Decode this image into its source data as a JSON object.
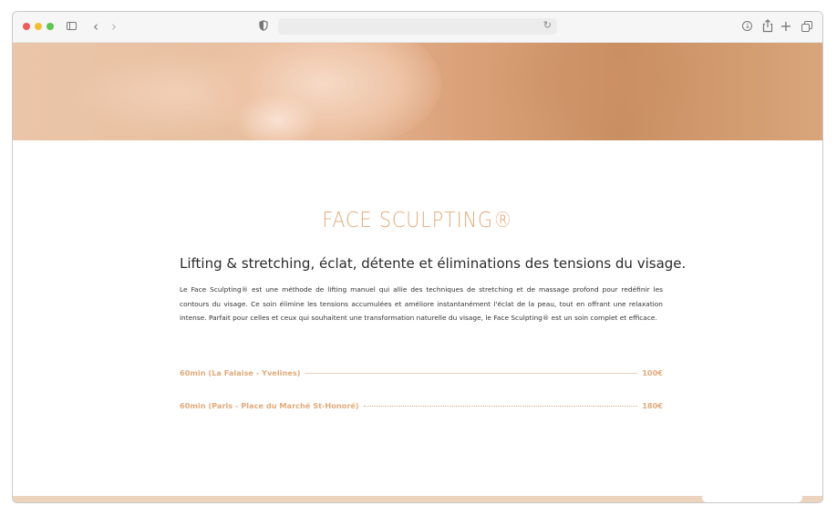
{
  "browser": {
    "url": "",
    "icons": {
      "sidebar": "sidebar-icon",
      "back": "chevron-left-icon",
      "forward": "chevron-right-icon",
      "shield": "shield-icon",
      "reload": "reload-icon",
      "download": "download-icon",
      "share": "share-icon",
      "new_tab": "plus-icon",
      "tabs": "tabs-overview-icon"
    },
    "glyphs": {
      "back": "‹",
      "forward": "›",
      "reload": "↻",
      "download_arrow": "↓",
      "plus": "+"
    },
    "traffic_colors": [
      "#ee5c57",
      "#f5bd32",
      "#5fc452"
    ]
  },
  "page": {
    "title": "FACE SCULPTING®",
    "subtitle": "Lifting & stretching, éclat, détente et éliminations des tensions du visage.",
    "description": "Le Face Sculpting® est une méthode de lifting manuel qui allie des techniques de stretching et de massage profond pour redéfinir les contours du visage. Ce soin élimine les tensions accumulées et améliore instantanément l'éclat de la peau, tout en offrant une relaxation intense. Parfait pour celles et ceux qui souhaitent une transformation naturelle du visage, le Face Sculpting® est un soin complet et efficace.",
    "prices": [
      {
        "label": "60min (La Falaise - Yvelines)",
        "price": "100€"
      },
      {
        "label": "60min (Paris - Place du Marché St-Honoré)",
        "price": "180€"
      }
    ],
    "accent_color": "#e2aa7b"
  }
}
